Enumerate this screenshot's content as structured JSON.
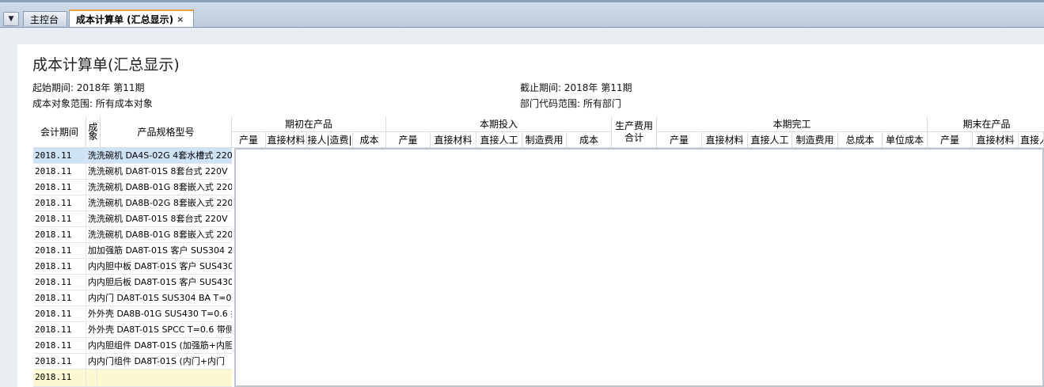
{
  "tabs": [
    {
      "label": "主控台"
    },
    {
      "label": "成本计算单 (汇总显示)",
      "close": "×"
    }
  ],
  "report": {
    "title": "成本计算单(汇总显示)",
    "start_period": "起始期间: 2018年 第11期",
    "end_period": "截止期间: 2018年 第11期",
    "scope": "成本对象范围: 所有成本对象",
    "dept_scope": "部门代码范围: 所有部门"
  },
  "grid": {
    "col_period": "会计期间",
    "col_obj_a": "成",
    "col_obj_b": "象",
    "col_spec": "产品规格型号",
    "groups": {
      "opening": "期初在产品",
      "current_input": "本期投入",
      "prod_cost_total": "生产费用",
      "completed": "本期完工",
      "closing": "期末在产品"
    },
    "sub": {
      "opening": [
        "产量",
        "直接材料",
        "接人|造费|",
        "成本"
      ],
      "current_input": [
        "产量",
        "直接材料",
        "直接人工",
        "制造费用",
        "成本"
      ],
      "prod_cost_total": "合计",
      "completed": [
        "产量",
        "直接材料",
        "直接人工",
        "制造费用",
        "总成本",
        "单位成本"
      ],
      "closing": [
        "产量",
        "直接材料",
        "直接人"
      ]
    },
    "rows": [
      {
        "period": "2018.11",
        "object": "洗洗碗机 DA4S-02G 4套水槽式 220"
      },
      {
        "period": "2018.11",
        "object": "洗洗碗机 DA8T-01S 8套台式 220V"
      },
      {
        "period": "2018.11",
        "object": "洗洗碗机 DA8B-01G 8套嵌入式 220"
      },
      {
        "period": "2018.11",
        "object": "洗洗碗机 DA8B-02G 8套嵌入式 220"
      },
      {
        "period": "2018.11",
        "object": "洗洗碗机 DA8T-01S 8套台式 220V"
      },
      {
        "period": "2018.11",
        "object": "洗洗碗机 DA8B-01G 8套嵌入式 220"
      },
      {
        "period": "2018.11",
        "object": "加加强筋 DA8T-01S 客户 SUS304 2"
      },
      {
        "period": "2018.11",
        "object": "内内胆中板 DA8T-01S 客户 SUS430"
      },
      {
        "period": "2018.11",
        "object": "内内胆后板 DA8T-01S 客户 SUS430"
      },
      {
        "period": "2018.11",
        "object": "内内门 DA8T-01S SUS304 BA T=0.4"
      },
      {
        "period": "2018.11",
        "object": "外外壳 DA8B-01G SUS430 T=0.6 拉"
      },
      {
        "period": "2018.11",
        "object": "外外壳 DA8T-01S SPCC T=0.6 带侧"
      },
      {
        "period": "2018.11",
        "object": "内内胆组件 DA8T-01S (加强筋+内胆"
      },
      {
        "period": "2018.11",
        "object": "内内门组件 DA8T-01S (内门+内门"
      },
      {
        "period": "2018.11",
        "object": ""
      }
    ]
  }
}
